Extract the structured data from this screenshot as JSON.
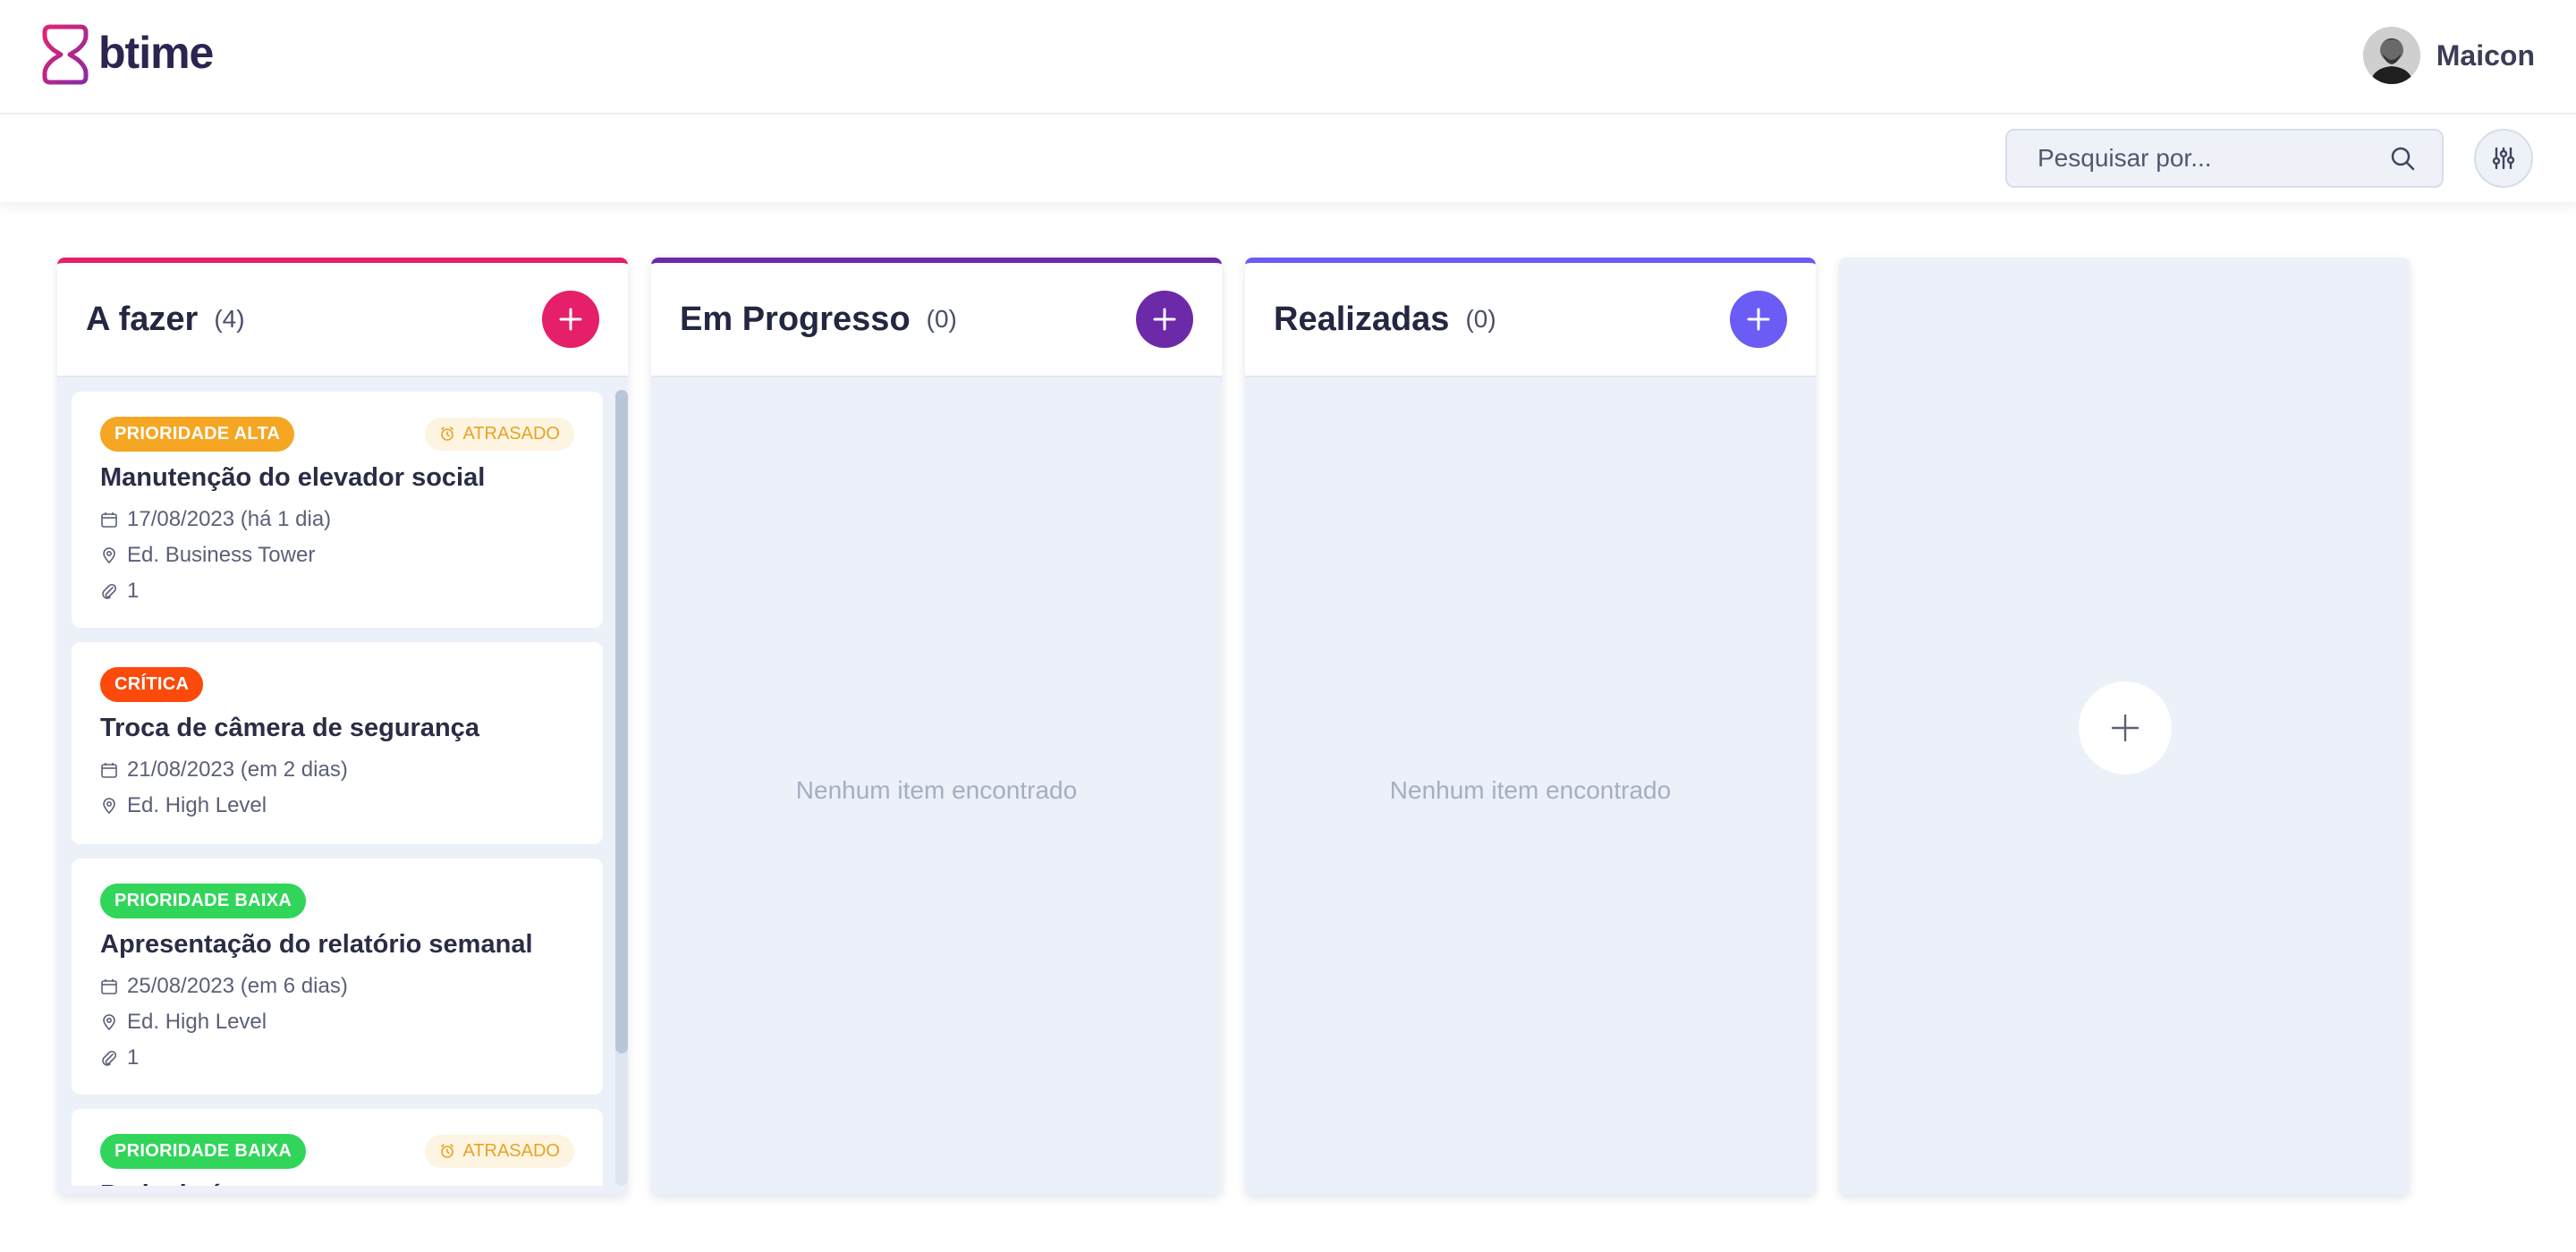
{
  "app": {
    "brand": "btime",
    "brand_colors": {
      "mark": "#d6246e",
      "text": "#2b2550"
    }
  },
  "user": {
    "name": "Maicon"
  },
  "search": {
    "placeholder": "Pesquisar por..."
  },
  "icons": {
    "logo": "btime-logo-icon",
    "search": "search-icon",
    "filter": "sliders-icon",
    "add": "plus-icon",
    "calendar": "calendar-icon",
    "location": "map-pin-icon",
    "attachment": "paperclip-icon",
    "alarm": "alarm-clock-icon"
  },
  "columns": [
    {
      "title": "A fazer",
      "count": "(4)",
      "accent": "#e51f6a",
      "cards": [
        {
          "badge": "PRIORIDADE ALTA",
          "badge_color": "#f5a623",
          "late": "ATRASADO",
          "title": "Manutenção do elevador social",
          "date": "17/08/2023 (há 1 dia)",
          "location": "Ed. Business Tower",
          "attachments": "1"
        },
        {
          "badge": "CRÍTICA",
          "badge_color": "#fb4a0c",
          "title": "Troca de câmera de segurança",
          "date": "21/08/2023 (em 2 dias)",
          "location": "Ed. High Level"
        },
        {
          "badge": "PRIORIDADE BAIXA",
          "badge_color": "#30d55a",
          "title": "Apresentação do relatório semanal",
          "date": "25/08/2023 (em 6 dias)",
          "location": "Ed. High Level",
          "attachments": "1"
        },
        {
          "badge": "PRIORIDADE BAIXA",
          "badge_color": "#30d55a",
          "late": "ATRASADO",
          "title": "Poda de árvores"
        }
      ]
    },
    {
      "title": "Em Progresso",
      "count": "(0)",
      "accent": "#6c2aa8",
      "empty": "Nenhum item encontrado"
    },
    {
      "title": "Realizadas",
      "count": "(0)",
      "accent": "#6a5cf4",
      "empty": "Nenhum item encontrado"
    }
  ]
}
